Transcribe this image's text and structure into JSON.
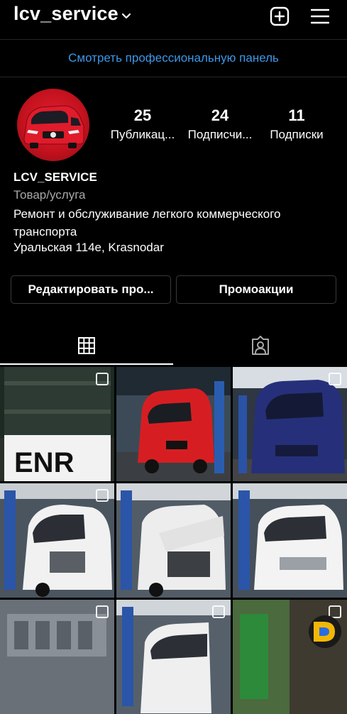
{
  "header": {
    "username": "lcv_service",
    "add_icon": "plus-square-icon",
    "menu_icon": "hamburger-menu-icon"
  },
  "pro_link": "Смотреть профессиональную панель",
  "profile": {
    "stats": [
      {
        "value": "25",
        "label": "Публикац..."
      },
      {
        "value": "24",
        "label": "Подписчи..."
      },
      {
        "value": "11",
        "label": "Подписки"
      }
    ],
    "name": "LCV_SERVICE",
    "category": "Товар/услуга",
    "description": "Ремонт и обслуживание легкого коммерческого транспорта",
    "address": "Уральская 114е, Krasnodar"
  },
  "buttons": {
    "edit": "Редактировать про...",
    "promo": "Промоакции"
  },
  "tabs": [
    {
      "icon": "grid-icon",
      "active": true
    },
    {
      "icon": "tagged-person-icon",
      "active": false
    }
  ],
  "colors": {
    "link": "#3d97e8",
    "background": "#000000",
    "avatar": "#c5121f"
  },
  "posts": [
    {
      "subject": "oil barrel",
      "multi": true
    },
    {
      "subject": "red van",
      "multi": false
    },
    {
      "subject": "blue van",
      "multi": true
    },
    {
      "subject": "white van hood open",
      "multi": true
    },
    {
      "subject": "white van engine",
      "multi": false
    },
    {
      "subject": "white van on lift",
      "multi": false
    },
    {
      "subject": "engine",
      "multi": true
    },
    {
      "subject": "white van",
      "multi": true
    },
    {
      "subject": "workshop",
      "multi": true
    }
  ]
}
